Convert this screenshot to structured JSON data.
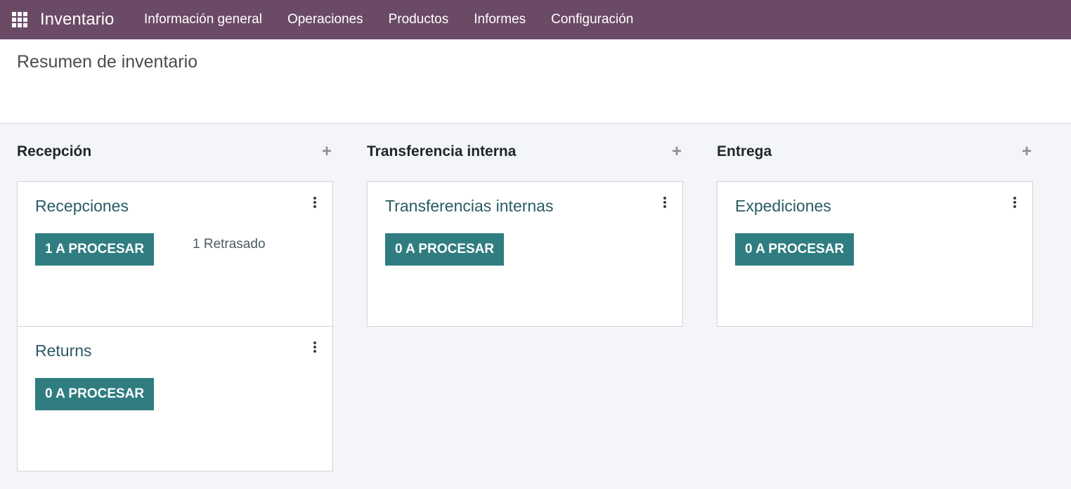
{
  "navbar": {
    "app_name": "Inventario",
    "apps_icon": "grid-icon",
    "menu": [
      {
        "label": "Información general"
      },
      {
        "label": "Operaciones"
      },
      {
        "label": "Productos"
      },
      {
        "label": "Informes"
      },
      {
        "label": "Configuración"
      }
    ]
  },
  "page": {
    "title": "Resumen de inventario"
  },
  "columns": [
    {
      "title": "Recepción",
      "add_icon": "+",
      "cards": [
        {
          "title": "Recepciones",
          "button": "1 A PROCESAR",
          "late": "1 Retrasado"
        },
        {
          "title": "Returns",
          "button": "0 A PROCESAR"
        }
      ]
    },
    {
      "title": "Transferencia interna",
      "add_icon": "+",
      "cards": [
        {
          "title": "Transferencias internas",
          "button": "0 A PROCESAR"
        }
      ]
    },
    {
      "title": "Entrega",
      "add_icon": "+",
      "cards": [
        {
          "title": "Expediciones",
          "button": "0 A PROCESAR"
        }
      ]
    }
  ],
  "colors": {
    "navbar": "#6b4a66",
    "button": "#2f7d80",
    "card_title": "#2a5b63",
    "background": "#f4f5f9"
  }
}
